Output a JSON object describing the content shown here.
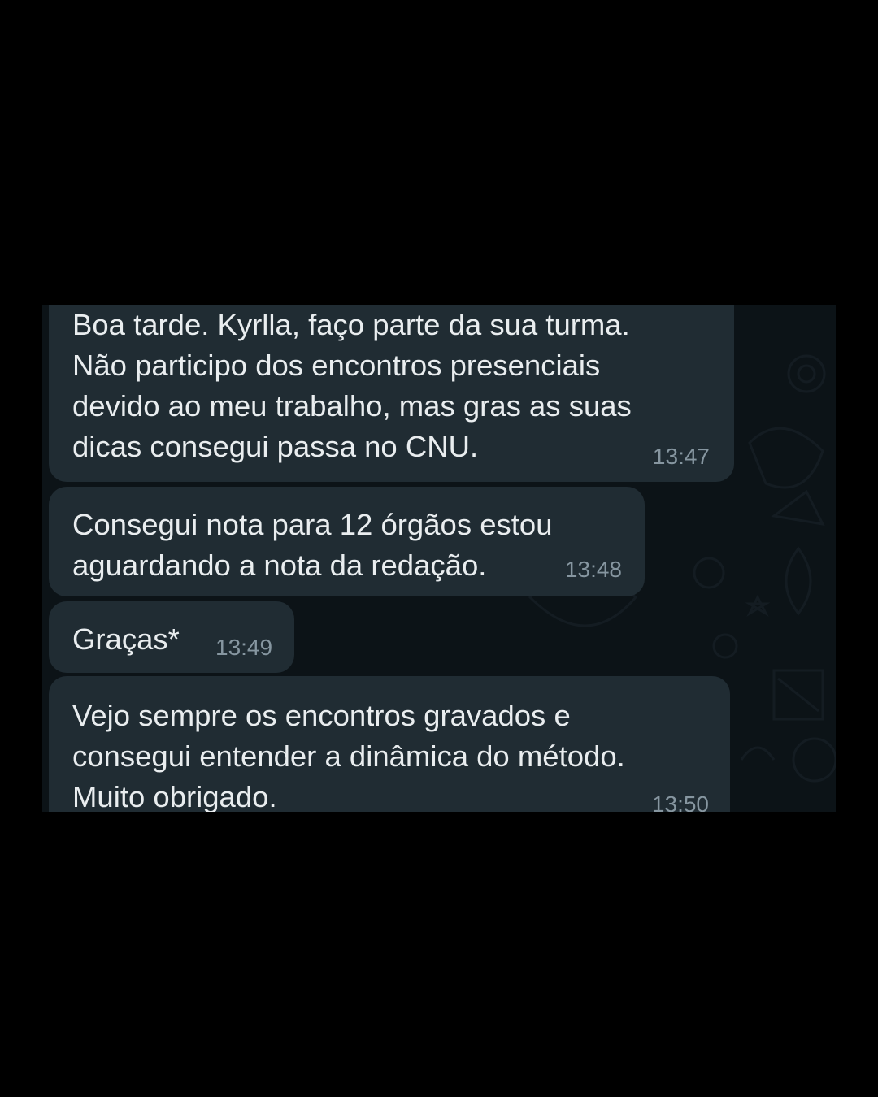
{
  "chat": {
    "messages": [
      {
        "text": "Boa tarde. Kyrlla, faço parte da sua turma.\nNão participo dos encontros presenciais\ndevido ao meu trabalho, mas gras as suas\ndicas consegui passa no CNU.",
        "time": "13:47"
      },
      {
        "text": "Consegui nota para 12 órgãos estou\naguardando a nota da redação.",
        "time": "13:48"
      },
      {
        "text": "Graças*",
        "time": "13:49"
      },
      {
        "text": "Vejo sempre os encontros gravados e\nconsegui entender a dinâmica do método.\nMuito obrigado.",
        "time": "13:50"
      }
    ]
  },
  "colors": {
    "page_background": "#000000",
    "chat_background": "#0c1317",
    "bubble_incoming": "#202c33",
    "message_text": "#e9edef",
    "timestamp_text": "#8696a0"
  }
}
